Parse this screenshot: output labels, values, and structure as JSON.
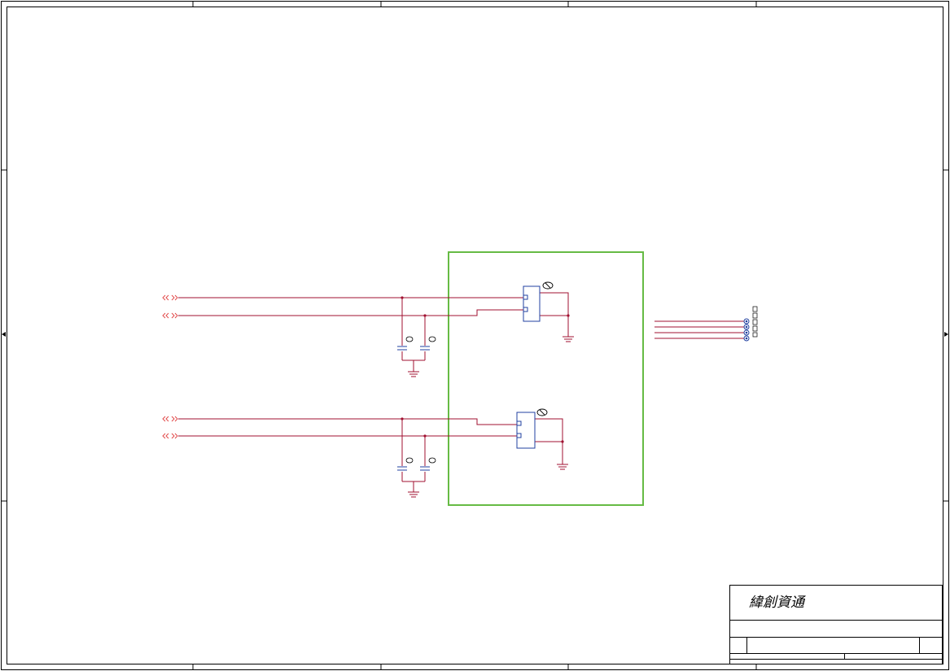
{
  "title_block": {
    "company": "緯創資通"
  },
  "colors": {
    "wire": "#a01030",
    "component": "#2040a0",
    "highlight_box": "#66bb44",
    "net_port": "#e04040",
    "frame": "#000000"
  },
  "icons": {
    "net_port": "double-chevron-port-icon",
    "ground": "ground-icon",
    "capacitor": "capacitor-icon",
    "connector": "connector-icon",
    "junction": "junction-dot-icon"
  }
}
